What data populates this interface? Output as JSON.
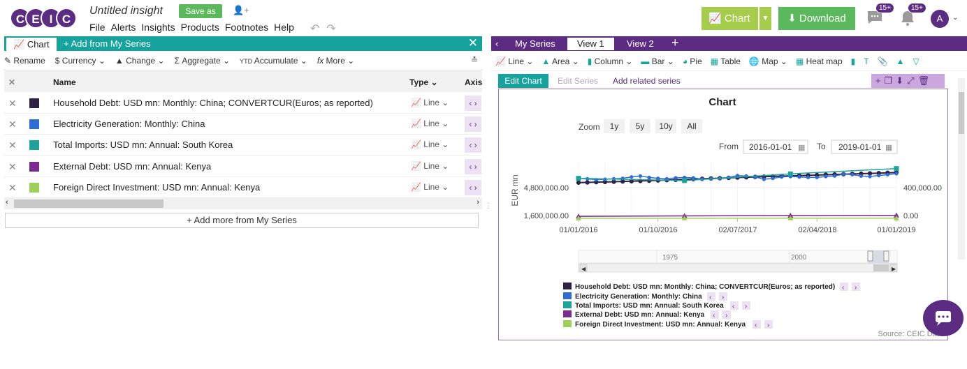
{
  "header": {
    "logo_letters": [
      "C",
      "E",
      "I",
      "C"
    ],
    "title": "Untitled insight",
    "save_as": "Save as",
    "menu": [
      "File",
      "Alerts",
      "Insights",
      "Products",
      "Footnotes",
      "Help"
    ],
    "chart_button": "Chart",
    "download_button": "Download",
    "messages_badge": "15+",
    "notifications_badge": "15+",
    "avatar_letter": "A"
  },
  "left_panel": {
    "tab_chart": "Chart",
    "tab_add": "Add from My Series",
    "tools": [
      "Rename",
      "Currency",
      "Change",
      "Aggregate",
      "Accumulate",
      "More"
    ],
    "columns": {
      "name": "Name",
      "type": "Type",
      "axis": "Axis"
    },
    "rows": [
      {
        "name": "Household Debt: USD mn: Monthly: China; CONVERTCUR(Euros; as reported)",
        "type": "Line",
        "color": "#2e2145"
      },
      {
        "name": "Electricity Generation: Monthly: China",
        "type": "Line",
        "color": "#2f6cd6"
      },
      {
        "name": "Total Imports: USD mn: Annual: South Korea",
        "type": "Line",
        "color": "#1ea39a"
      },
      {
        "name": "External Debt: USD mn: Annual: Kenya",
        "type": "Line",
        "color": "#7b2a8f"
      },
      {
        "name": "Foreign Direct Investment: USD mn: Annual: Kenya",
        "type": "Line",
        "color": "#9ecf5a"
      }
    ],
    "add_more": "+ Add more from My Series"
  },
  "right_panel": {
    "tabs": [
      "My Series",
      "View 1",
      "View 2"
    ],
    "active_tab": "View 1",
    "chart_types": [
      "Line",
      "Area",
      "Column",
      "Bar",
      "Pie",
      "Table",
      "Map",
      "Heat map"
    ],
    "edit_chart": "Edit Chart",
    "edit_series": "Edit Series",
    "add_related": "Add related series"
  },
  "chart": {
    "title": "Chart",
    "zoom_label": "Zoom",
    "zoom_options": [
      "1y",
      "5y",
      "10y",
      "All"
    ],
    "from_label": "From",
    "from_value": "2016-01-01",
    "to_label": "To",
    "to_value": "2019-01-01",
    "left_axis_label": "EUR mn",
    "left_ticks": [
      "4,800,000.00",
      "1,600,000.00"
    ],
    "right_ticks": [
      "400,000.00",
      "0.00"
    ],
    "x_ticks": [
      "01/01/2016",
      "01/10/2016",
      "02/07/2017",
      "02/04/2018",
      "01/01/2019"
    ],
    "navigator_ticks": [
      "1975",
      "2000"
    ],
    "source": "Source: CEIC Data"
  },
  "chart_data": {
    "type": "line",
    "title": "Chart",
    "xlabel": "",
    "ylabel": "EUR mn",
    "x_ticks": [
      "01/01/2016",
      "01/10/2016",
      "02/07/2017",
      "02/04/2018",
      "01/01/2019"
    ],
    "left_ylim": [
      0,
      6400000
    ],
    "right_ylim": [
      0,
      600000
    ],
    "series": [
      {
        "name": "Household Debt: USD mn: Monthly: China; CONVERTCUR(Euros; as reported)",
        "color": "#2e2145",
        "axis": "left",
        "values": [
          4100000,
          4120000,
          4150000,
          4170000,
          4200000,
          4230000,
          4260000,
          4290000,
          4320000,
          4350000,
          4390000,
          4420000,
          4460000,
          4490000,
          4530000,
          4570000,
          4600000,
          4640000,
          4680000,
          4710000,
          4750000,
          4780000,
          4810000,
          4840000,
          4870000,
          4900000,
          4930000,
          4960000,
          5000000,
          5030000,
          5060000,
          5090000,
          5120000,
          5150000,
          5180000,
          5220000,
          5260000
        ]
      },
      {
        "name": "Electricity Generation: Monthly: China",
        "color": "#2f6cd6",
        "axis": "right",
        "values": [
          430000,
          425000,
          415000,
          420000,
          425000,
          430000,
          445000,
          455000,
          440000,
          430000,
          425000,
          435000,
          440000,
          435000,
          420000,
          425000,
          430000,
          440000,
          460000,
          455000,
          445000,
          420000,
          430000,
          445000,
          450000,
          445000,
          440000,
          440000,
          450000,
          455000,
          475000,
          470000,
          455000,
          450000,
          460000,
          470000,
          480000
        ]
      },
      {
        "name": "Total Imports: USD mn: Annual: South Korea",
        "color": "#1ea39a",
        "axis": "right",
        "values": [
          430000,
          406000,
          478000,
          535000
        ]
      },
      {
        "name": "External Debt: USD mn: Annual: Kenya",
        "color": "#7b2a8f",
        "axis": "right",
        "values": [
          22000,
          26000,
          30000,
          32000
        ]
      },
      {
        "name": "Foreign Direct Investment: USD mn: Annual: Kenya",
        "color": "#9ecf5a",
        "axis": "right",
        "values": [
          1300,
          1100,
          1600,
          1400
        ]
      }
    ]
  },
  "colors": {
    "teal": "#17a39d",
    "purple": "#5b2c82",
    "green": "#5cb85c",
    "lime": "#a6cc4c"
  }
}
